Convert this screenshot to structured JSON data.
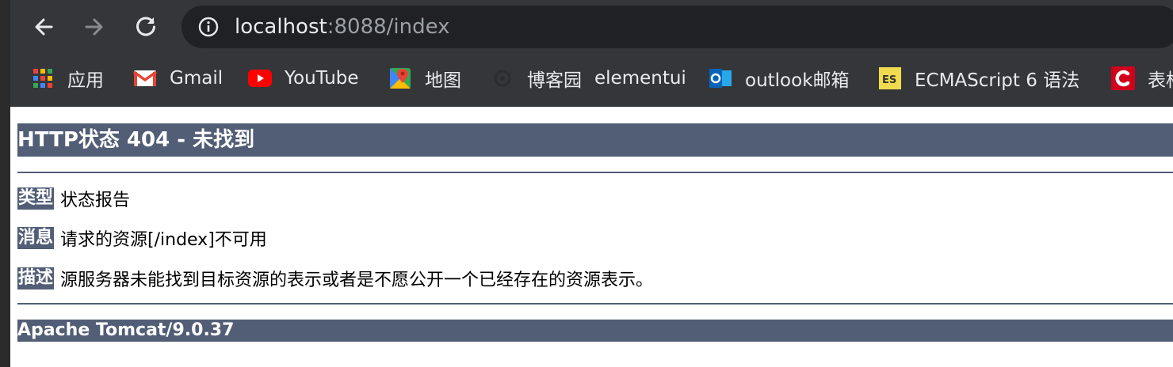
{
  "browser": {
    "address_bar": {
      "host": "localhost",
      "path": ":8088/index"
    },
    "bookmarks": [
      {
        "label": "应用",
        "icon": "apps-grid-icon"
      },
      {
        "label": "Gmail",
        "icon": "gmail-icon"
      },
      {
        "label": "YouTube",
        "icon": "youtube-icon"
      },
      {
        "label": "地图",
        "icon": "maps-icon"
      },
      {
        "label": "博客园",
        "icon": "cnblogs-icon"
      },
      {
        "label": "elementui",
        "icon": ""
      },
      {
        "label": "outlook邮箱",
        "icon": "outlook-icon"
      },
      {
        "label": "ECMAScript 6 语法",
        "icon": "es-icon"
      },
      {
        "label": "表格",
        "icon": "red-c-icon"
      }
    ]
  },
  "page": {
    "title": "HTTP状态 404 - 未找到",
    "rows": [
      {
        "label": "类型",
        "text": "状态报告"
      },
      {
        "label": "消息",
        "text": "请求的资源[/index]不可用"
      },
      {
        "label": "描述",
        "text": "源服务器未能找到目标资源的表示或者是不愿公开一个已经存在的资源表示。"
      }
    ],
    "footer": "Apache Tomcat/9.0.37"
  },
  "colors": {
    "chrome_bg": "#35363a",
    "omnibox_bg": "#202124",
    "tomcat_header": "#525d76"
  }
}
